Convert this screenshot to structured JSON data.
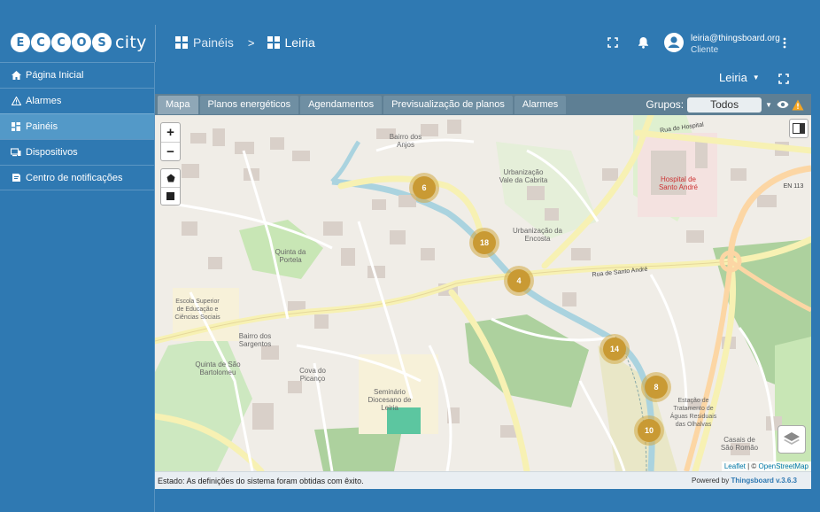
{
  "logo": {
    "letters": [
      "E",
      "C",
      "C",
      "O",
      "S"
    ],
    "suffix": "city"
  },
  "breadcrumb": {
    "first": "Painéis",
    "separator": ">",
    "second": "Leiria"
  },
  "user": {
    "email": "leiria@thingsboard.org",
    "role": "Cliente"
  },
  "sidebar": {
    "items": [
      {
        "label": "Página Inicial",
        "icon": "home-icon"
      },
      {
        "label": "Alarmes",
        "icon": "warning-icon"
      },
      {
        "label": "Painéis",
        "icon": "dashboard-icon"
      },
      {
        "label": "Dispositivos",
        "icon": "devices-icon"
      },
      {
        "label": "Centro de notificações",
        "icon": "notifications-center-icon"
      }
    ],
    "active_index": 2
  },
  "dashboard": {
    "state_selector": "Leiria"
  },
  "tabs": [
    {
      "label": "Mapa",
      "active": true
    },
    {
      "label": "Planos energéticos",
      "active": false
    },
    {
      "label": "Agendamentos",
      "active": false
    },
    {
      "label": "Previsualização de planos",
      "active": false
    },
    {
      "label": "Alarmes",
      "active": false
    }
  ],
  "groups": {
    "label": "Grupos:",
    "value": "Todos"
  },
  "map": {
    "zoom_in": "+",
    "zoom_out": "−",
    "clusters": [
      "6",
      "18",
      "4",
      "14",
      "8",
      "10"
    ],
    "labels": {
      "bairro_anjos": "Bairro dos Anjos",
      "urbanizacao_cabrita": "Urbanização Vale da Cabrita",
      "urbanizacao_encosta": "Urbanização da Encosta",
      "hospital": "Hospital de Santo André",
      "quinta_portela": "Quinta da Portela",
      "escola": "Escola Superior de Educação e Ciências Sociais",
      "bairro_sargentos": "Bairro dos Sargentos",
      "quinta_bartolomeu": "Quinta de São Bartolomeu",
      "cova_picanco": "Cova do Picanço",
      "seminario": "Seminário Diocesano de Leiria",
      "estacao": "Estação de Tratamento de Águas Residuais das Olhalvas",
      "casais": "Casais de São Romão",
      "en113": "EN 113",
      "rua_hospital": "Rua do Hospital",
      "rua_santo_andre": "Rua de Santo André"
    },
    "attribution": {
      "leaflet": "Leaflet",
      "separator": " | © ",
      "osm": "OpenStreetMap"
    }
  },
  "status": {
    "text": "Estado: As definições do sistema foram obtidas com êxito.",
    "powered_prefix": "Powered by ",
    "powered_brand": "Thingsboard v.3.6.3"
  },
  "colors": {
    "primary": "#2f79b2",
    "active_nav": "#5399c8",
    "cluster": "#c99a34",
    "warning": "#f5a623"
  }
}
